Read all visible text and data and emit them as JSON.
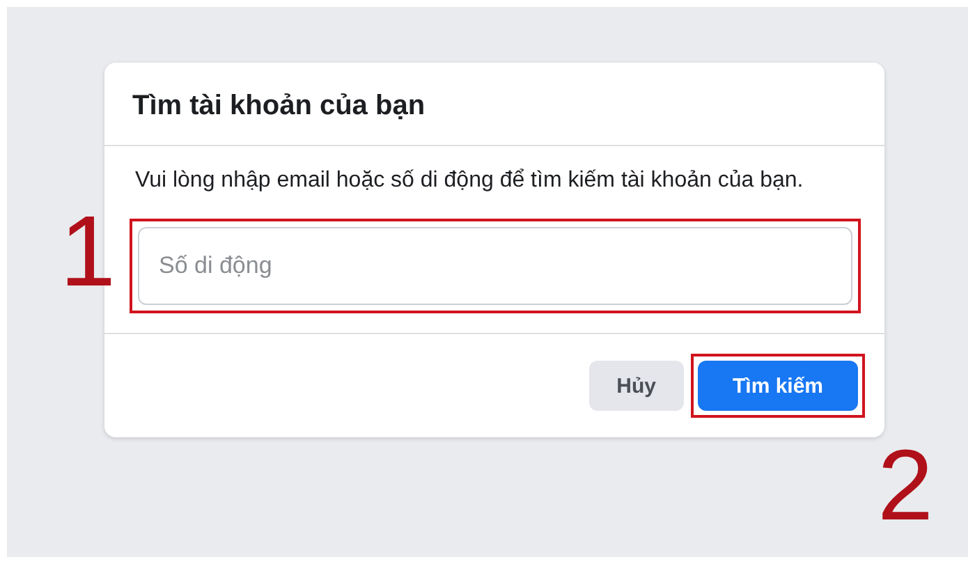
{
  "dialog": {
    "title": "Tìm tài khoản của bạn",
    "instruction": "Vui lòng nhập email hoặc số di động để tìm kiếm tài khoản của bạn.",
    "field": {
      "placeholder": "Số di động",
      "highlighted": true
    },
    "buttons": [
      {
        "label": "Hủy",
        "kind": "secondary",
        "highlighted": false
      },
      {
        "label": "Tìm kiếm",
        "kind": "primary",
        "highlighted": true
      }
    ]
  },
  "annotations": [
    {
      "label": "1"
    },
    {
      "label": "2"
    }
  ]
}
